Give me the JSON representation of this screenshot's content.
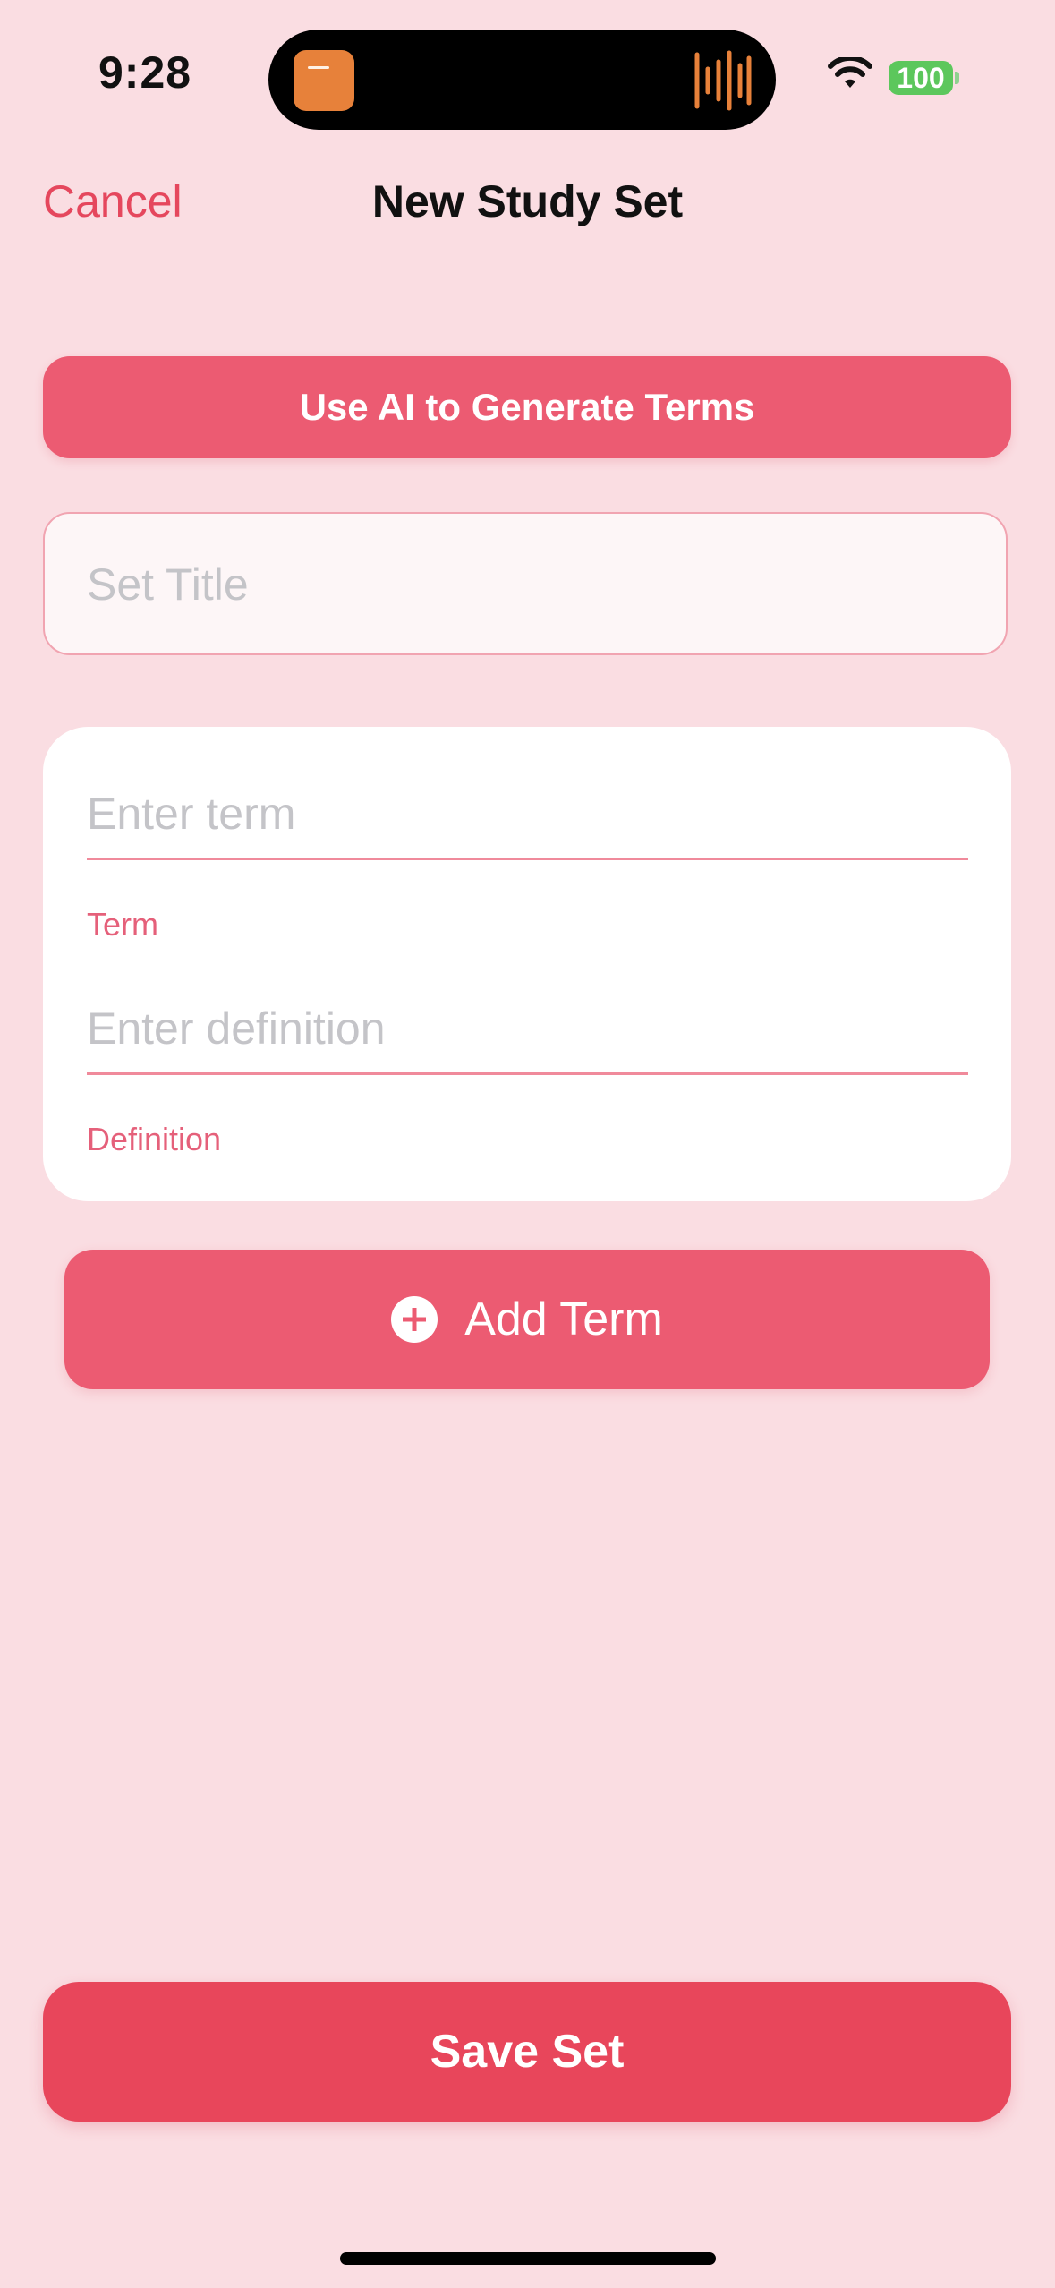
{
  "status_bar": {
    "time": "9:28",
    "battery": "100"
  },
  "nav": {
    "cancel_label": "Cancel",
    "title": "New Study Set"
  },
  "ai_button_label": "Use AI to Generate Terms",
  "set_title_placeholder": "Set Title",
  "term_card": {
    "term_placeholder": "Enter term",
    "term_label": "Term",
    "definition_placeholder": "Enter definition",
    "definition_label": "Definition"
  },
  "add_term_label": "Add Term",
  "save_label": "Save Set",
  "colors": {
    "background": "#fadde2",
    "accent": "#ec5b72",
    "save": "#e8465b",
    "battery": "#5cc75c"
  }
}
